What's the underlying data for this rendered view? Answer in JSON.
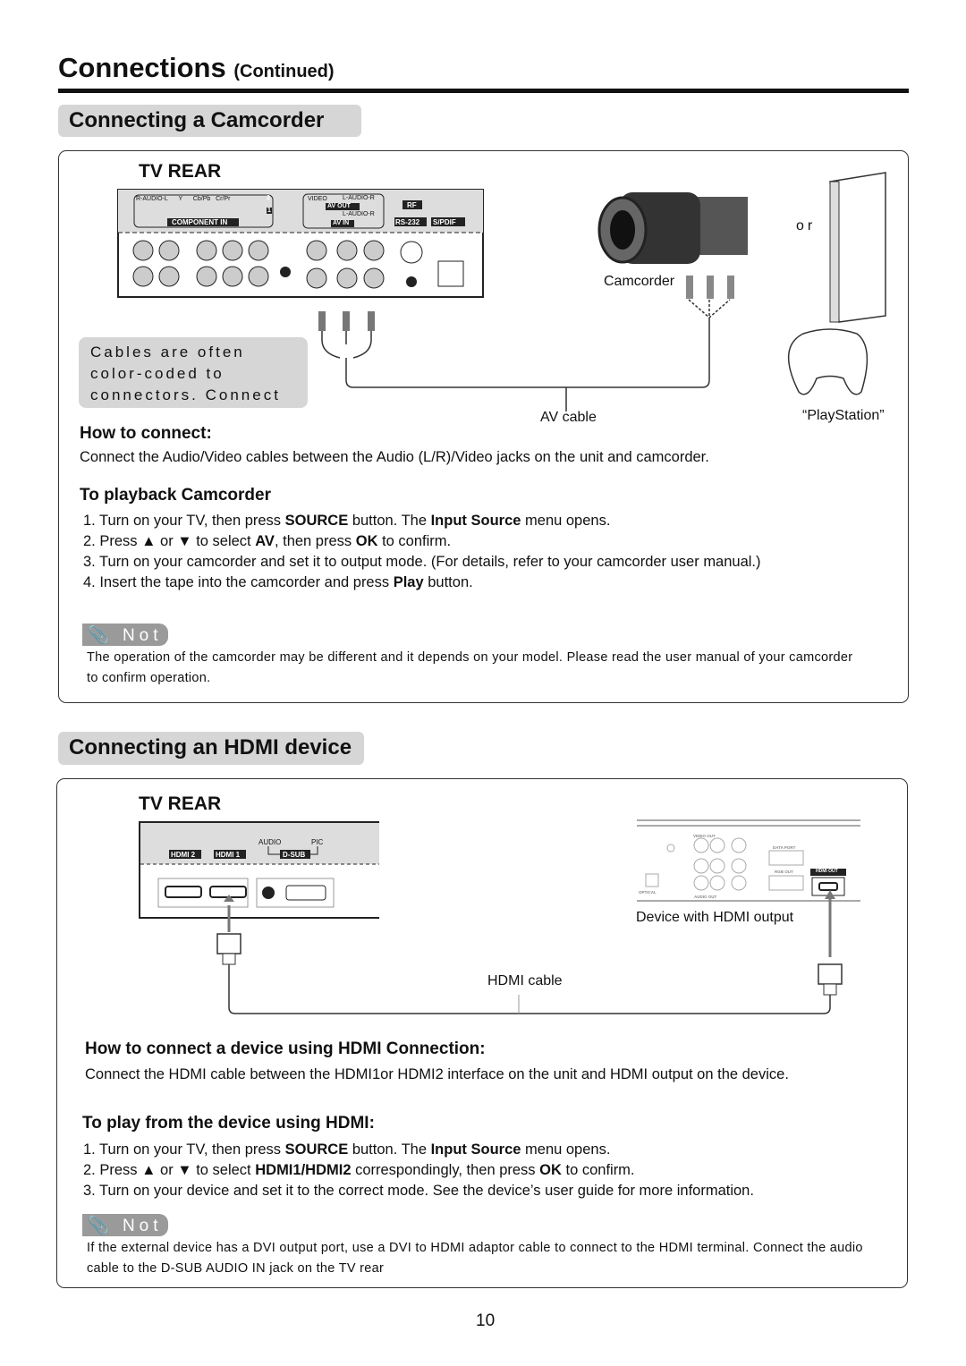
{
  "header": {
    "title": "Connections",
    "continued": "(Continued)"
  },
  "camcorder": {
    "section_title": "Connecting a Camcorder",
    "tv_rear": "TV REAR",
    "panel_labels": {
      "audio": "R-AUDIO-L",
      "y": "Y",
      "cb": "Cb/Pb",
      "cr": "Cr/Pr",
      "num2": "2",
      "num1": "1",
      "component_in": "COMPONENT IN",
      "video": "VIDEO",
      "audio_lr": "L-AUDIO-R",
      "av_out": "AV OUT",
      "av_in": "AV IN",
      "rf": "RF",
      "rs232": "RS-232",
      "spdif": "S/PDIF"
    },
    "cable_note": "Cables are often color-coded to connectors. Connect red to red, white to white, etc.",
    "camcorder_label": "Camcorder",
    "or_label": "or",
    "playstation_label": "“PlayStation”",
    "av_cable_label": "AV cable",
    "how_heading": "How to connect:",
    "how_text": "Connect the Audio/Video cables between the Audio (L/R)/Video jacks on the unit and camcorder.",
    "playback_heading": "To playback Camcorder",
    "steps": [
      {
        "pre": "1. Turn on your TV,  then press ",
        "b1": "SOURCE",
        "mid": " button. The ",
        "b2": "Input Source",
        "post": " menu opens."
      },
      {
        "pre": "2. Press ▲ or ▼ to select ",
        "b1": "AV",
        "mid": ", then press ",
        "b2": "OK",
        "post": " to confirm."
      },
      {
        "pre": "3. Turn on your camcorder and set it to output mode. (For details, refer to your camcorder user manual.)",
        "b1": "",
        "mid": "",
        "b2": "",
        "post": ""
      },
      {
        "pre": "4. Insert the tape into the camcorder and press ",
        "b1": "Play",
        "mid": " button.",
        "b2": "",
        "post": ""
      }
    ],
    "note_label": "Not",
    "note_line1": "The operation of the camcorder may be different and it depends on your model. Please read the user manual of your camcorder",
    "note_line2": "to confirm operation."
  },
  "hdmi": {
    "section_title": "Connecting an HDMI device",
    "tv_rear": "TV REAR",
    "panel_labels": {
      "hdmi2": "HDMI 2",
      "hdmi1": "HDMI 1",
      "audio": "AUDIO",
      "pic": "PIC",
      "dsub": "D-SUB"
    },
    "device_labels": {
      "hdmi_out": "HDMI OUT",
      "data_port": "DATA PORT",
      "rgb_out": "RGB OUT",
      "video_out": "VIDEO OUT",
      "audio_out": "AUDIO OUT",
      "optical": "OPTICAL"
    },
    "device_label": "Device with HDMI output",
    "cable_label": "HDMI cable",
    "how_heading": "How to connect a device using HDMI Connection:",
    "how_text": "Connect the HDMI cable between the HDMI1or HDMI2 interface on the unit and HDMI output on the device.",
    "play_heading": "To play from the device using HDMI:",
    "steps": [
      {
        "pre": "1. Turn on your TV,  then press ",
        "b1": "SOURCE",
        "mid": " button. The ",
        "b2": "Input Source",
        "post": " menu opens."
      },
      {
        "pre": "2. Press ▲ or ▼ to select ",
        "b1": "HDMI1/HDMI2",
        "mid": " correspondingly, then press ",
        "b2": "OK",
        "post": " to confirm."
      },
      {
        "pre": "3. Turn on your device and set it to the correct mode. See the device’s user guide for more information.",
        "b1": "",
        "mid": "",
        "b2": "",
        "post": ""
      }
    ],
    "note_label": "Not",
    "note_line1": "If the external device has a DVI output port, use a DVI to HDMI adaptor cable to connect to the HDMI terminal. Connect the audio",
    "note_line2": "cable to the D-SUB AUDIO IN jack on the TV rear"
  },
  "footer": {
    "page_number": "10"
  }
}
